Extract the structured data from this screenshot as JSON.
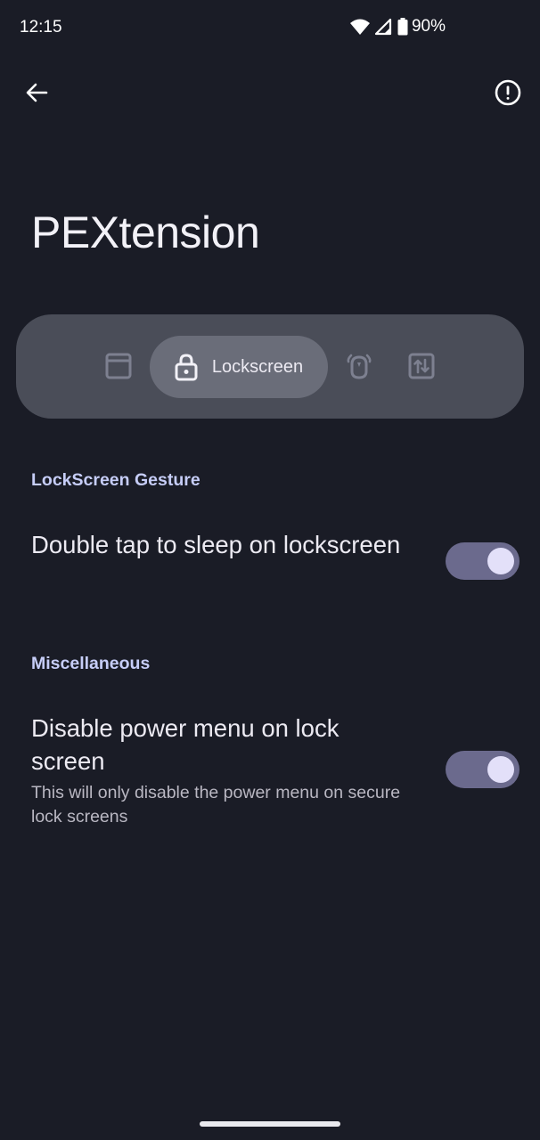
{
  "status_bar": {
    "time": "12:15",
    "battery": "90%",
    "icons": [
      "wifi-icon",
      "cell-signal-icon",
      "battery-icon"
    ]
  },
  "app_bar": {
    "back_icon": "arrow-back-icon",
    "info_icon": "info-icon"
  },
  "title": "PEXtension",
  "nav": {
    "items": [
      {
        "icon": "window-icon",
        "label": ""
      },
      {
        "icon": "lock-icon",
        "label": "Lockscreen",
        "selected": true
      },
      {
        "icon": "dnd-bell-icon",
        "label": ""
      },
      {
        "icon": "sort-arrows-icon",
        "label": ""
      }
    ]
  },
  "sections": [
    {
      "header": "LockScreen Gesture",
      "prefs": [
        {
          "title": "Double tap to sleep on lockscreen",
          "summary": "",
          "checked": true
        }
      ]
    },
    {
      "header": "Miscellaneous",
      "prefs": [
        {
          "title": "Disable power menu on lock screen",
          "summary": "This will only disable the power menu on secure lock screens",
          "checked": true
        }
      ]
    }
  ],
  "colors": {
    "background": "#1a1c26",
    "nav_bg": "#4a4d58",
    "nav_selected": "#6a6d79",
    "section_header": "#c6cdf7",
    "toggle_track": "#6b6a8d",
    "toggle_thumb": "#e3e0f9"
  }
}
